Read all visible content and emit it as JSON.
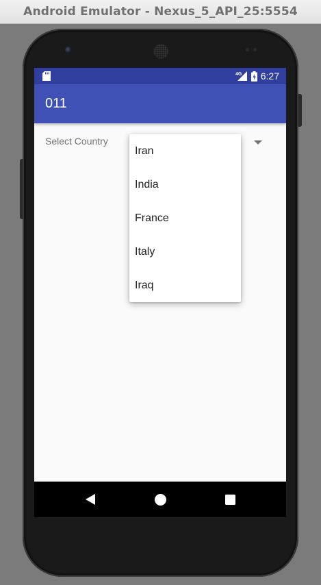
{
  "window": {
    "title": "Android Emulator - Nexus_5_API_25:5554"
  },
  "status_bar": {
    "network": "4G",
    "time": "6:27"
  },
  "app_bar": {
    "title": "011"
  },
  "spinner": {
    "label": "Select Country",
    "options": [
      "Iran",
      "India",
      "France",
      "Italy",
      "Iraq"
    ]
  },
  "nav_bar": {
    "back": "back-icon",
    "home": "home-icon",
    "recents": "recents-icon"
  },
  "colors": {
    "status_bar": "#303f9f",
    "app_bar": "#3f51b5",
    "background": "#fafafa"
  }
}
